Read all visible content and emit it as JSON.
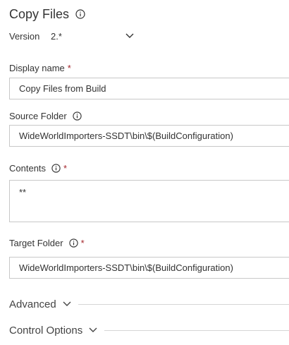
{
  "header": {
    "title": "Copy Files"
  },
  "version": {
    "label": "Version",
    "value": "2.*"
  },
  "fields": {
    "display_name": {
      "label": "Display name",
      "required": "*",
      "value": "Copy Files from Build"
    },
    "source_folder": {
      "label": "Source Folder",
      "value": "WideWorldImporters-SSDT\\bin\\$(BuildConfiguration)"
    },
    "contents": {
      "label": "Contents",
      "required": "*",
      "value": "**"
    },
    "target_folder": {
      "label": "Target Folder",
      "required": "*",
      "value": "WideWorldImporters-SSDT\\bin\\$(BuildConfiguration)"
    }
  },
  "sections": {
    "advanced": {
      "label": "Advanced"
    },
    "control_options": {
      "label": "Control Options"
    }
  }
}
